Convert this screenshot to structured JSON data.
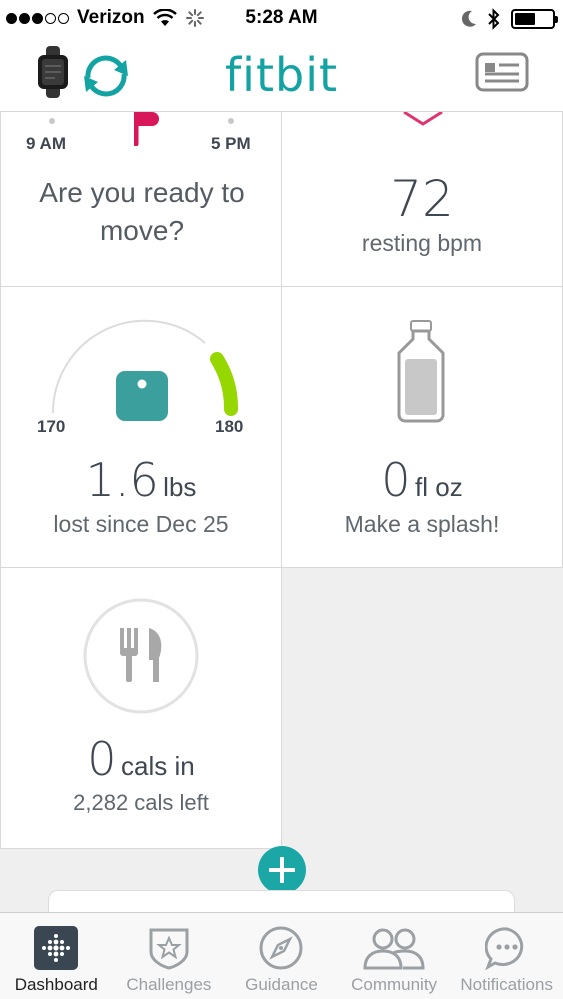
{
  "status_bar": {
    "carrier": "Verizon",
    "time": "5:28 AM",
    "signal_bars_filled": 3,
    "signal_bars_total": 5
  },
  "header": {
    "logo": "fitbit",
    "accent_color": "#14a3a3"
  },
  "tiles": {
    "move": {
      "start_time": "9 AM",
      "end_time": "5 PM",
      "message": "Are you ready to move?"
    },
    "heart_rate": {
      "value": "72",
      "label": "resting bpm"
    },
    "weight": {
      "gauge_min": "170",
      "gauge_max": "180",
      "value": "1.6",
      "unit": "lbs",
      "label": "lost since Dec 25"
    },
    "water": {
      "value": "0",
      "unit": "fl oz",
      "label": "Make a splash!"
    },
    "food": {
      "value": "0",
      "unit": "cals in",
      "label": "2,282 cals left"
    }
  },
  "tab_bar": {
    "tabs": [
      {
        "label": "Dashboard",
        "icon": "dashboard-icon",
        "active": true
      },
      {
        "label": "Challenges",
        "icon": "challenges-star-icon",
        "active": false
      },
      {
        "label": "Guidance",
        "icon": "compass-icon",
        "active": false
      },
      {
        "label": "Community",
        "icon": "community-people-icon",
        "active": false
      },
      {
        "label": "Notifications",
        "icon": "speech-bubble-icon",
        "active": false
      }
    ]
  }
}
